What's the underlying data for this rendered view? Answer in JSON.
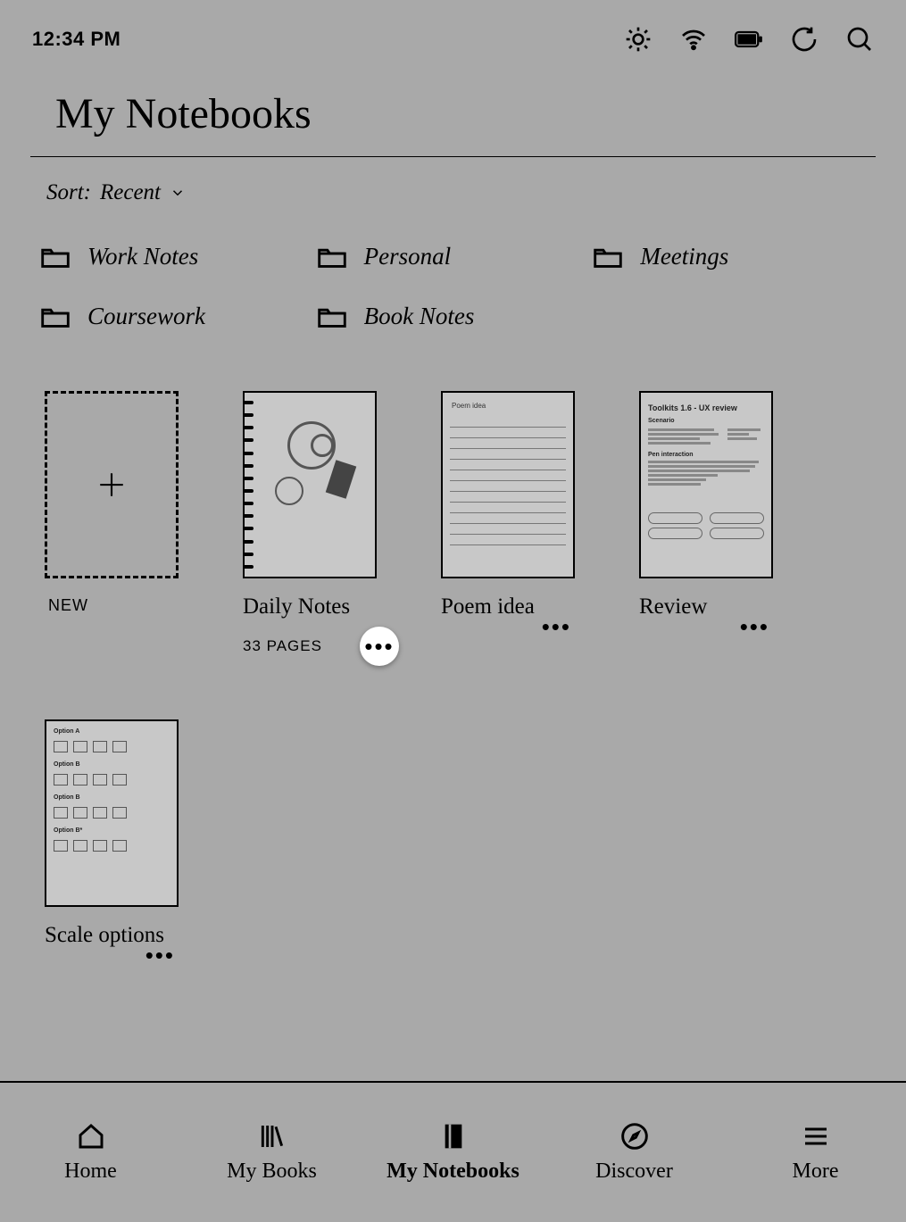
{
  "status": {
    "time": "12:34 PM"
  },
  "page": {
    "title": "My Notebooks"
  },
  "sort": {
    "prefix": "Sort: ",
    "value": "Recent"
  },
  "folders": [
    {
      "label": "Work Notes"
    },
    {
      "label": "Personal"
    },
    {
      "label": "Meetings"
    },
    {
      "label": "Coursework"
    },
    {
      "label": "Book Notes"
    }
  ],
  "new_label": "NEW",
  "notebooks": [
    {
      "title": "Daily Notes",
      "subtitle": "33 PAGES",
      "thumb_type": "spiral-sketch",
      "highlighted": true
    },
    {
      "title": "Poem idea",
      "subtitle": "",
      "thumb_type": "lined",
      "thumb_header": "Poem idea"
    },
    {
      "title": "Review",
      "subtitle": "",
      "thumb_type": "review",
      "thumb_header": "Toolkits 1.6 - UX review"
    },
    {
      "title": "Scale options",
      "subtitle": "",
      "thumb_type": "scale"
    }
  ],
  "review_sections": {
    "s1": "Scenario",
    "s2": "Pen interaction"
  },
  "scale_labels": [
    "Option A",
    "Option B",
    "Option B",
    "Option B*"
  ],
  "tabs": [
    {
      "label": "Home",
      "active": false
    },
    {
      "label": "My Books",
      "active": false
    },
    {
      "label": "My Notebooks",
      "active": true
    },
    {
      "label": "Discover",
      "active": false
    },
    {
      "label": "More",
      "active": false
    }
  ]
}
